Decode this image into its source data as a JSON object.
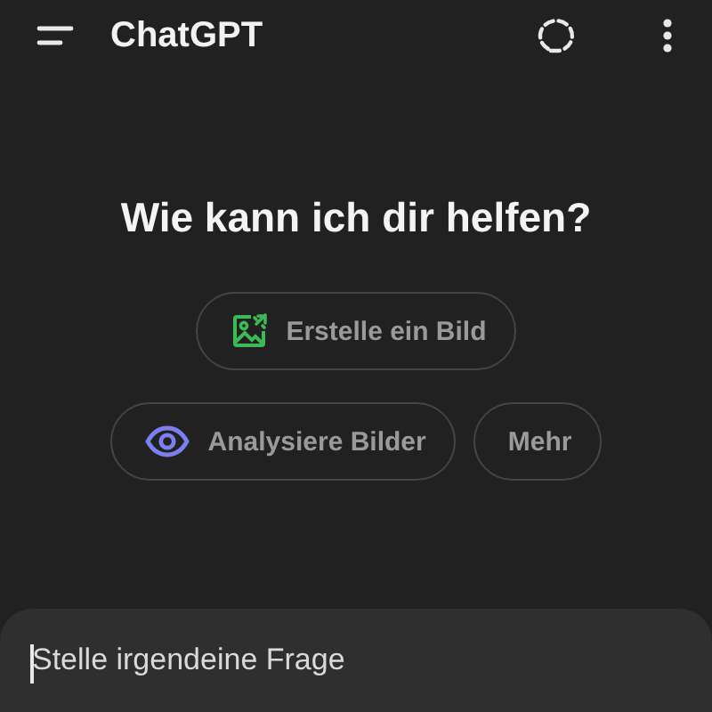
{
  "header": {
    "title": "ChatGPT"
  },
  "heading": "Wie kann ich dir helfen?",
  "suggestions": [
    {
      "kind": "image",
      "label": "Erstelle ein Bild"
    },
    {
      "kind": "eye",
      "label": "Analysiere Bilder"
    },
    {
      "kind": "plain",
      "label": "Mehr"
    }
  ],
  "composer": {
    "placeholder": "Stelle irgendeine Frage"
  }
}
